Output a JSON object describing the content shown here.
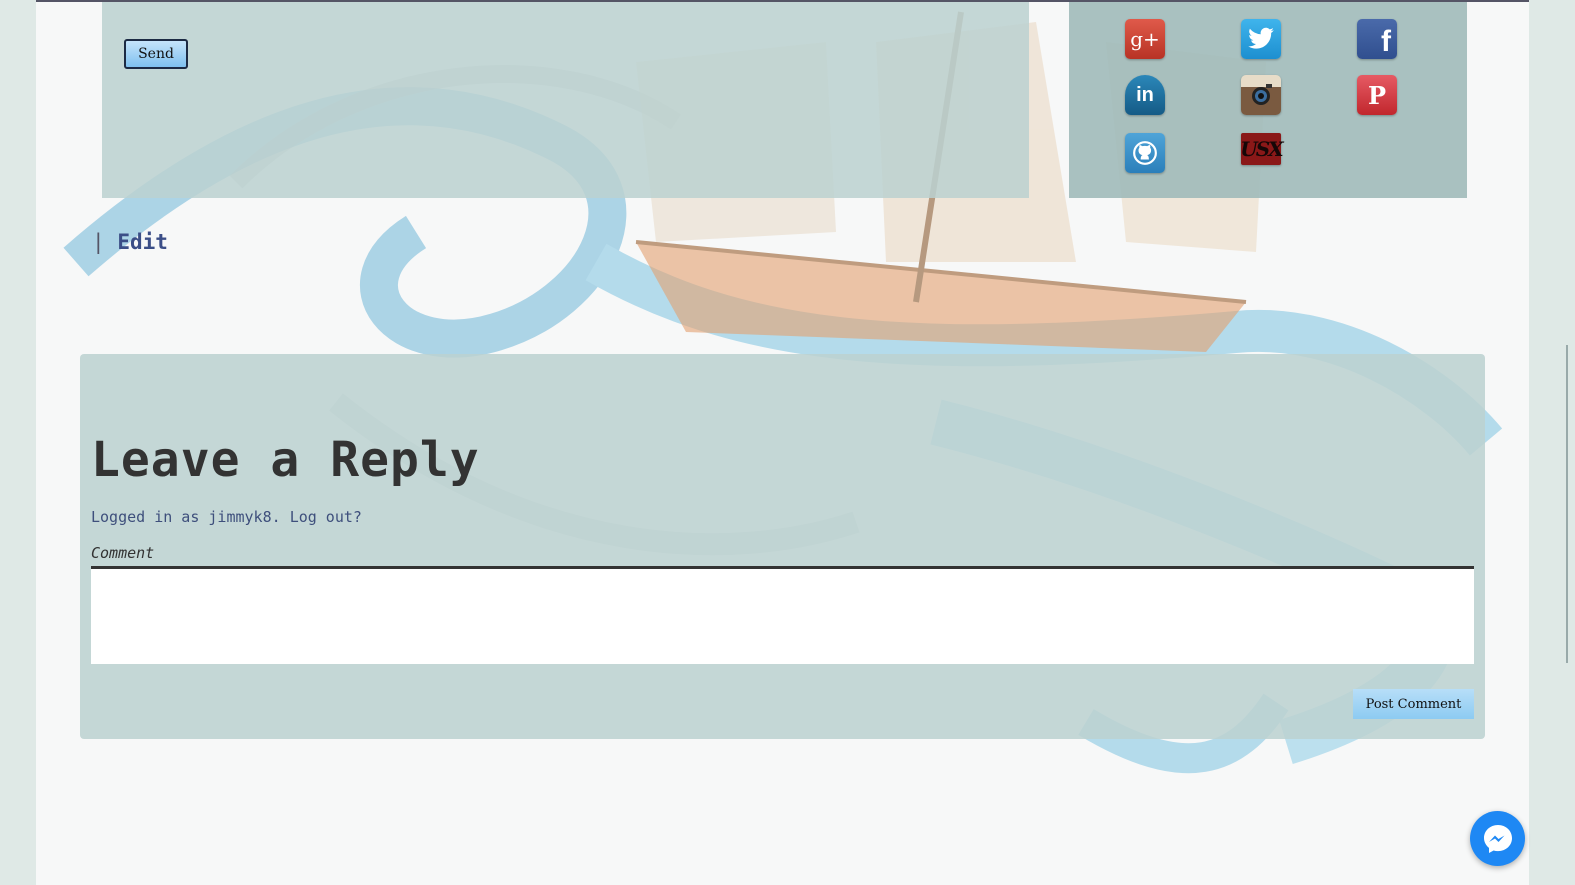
{
  "contact_form": {
    "send_label": "Send"
  },
  "social": {
    "icons": [
      {
        "name": "google-plus-icon",
        "glyph": "g+"
      },
      {
        "name": "twitter-icon",
        "glyph": ""
      },
      {
        "name": "facebook-icon",
        "glyph": "f"
      },
      {
        "name": "linkedin-icon",
        "glyph": "in"
      },
      {
        "name": "instagram-icon",
        "glyph": ""
      },
      {
        "name": "pinterest-icon",
        "glyph": "P"
      },
      {
        "name": "github-icon",
        "glyph": ""
      },
      {
        "name": "custom-logo-icon",
        "glyph": "USX"
      }
    ]
  },
  "post": {
    "separator": "|",
    "edit_label": "Edit"
  },
  "reply": {
    "title": "Leave a Reply",
    "logged_in_prefix": "Logged in as",
    "username": "jimmyk8",
    "log_out_label": "Log out?",
    "comment_label": "Comment",
    "comment_value": "",
    "post_button_label": "Post Comment"
  },
  "colors": {
    "panel": "#bcd2d0",
    "link": "#3b4e87",
    "button_gradient_top": "#c5e4fb",
    "messenger": "#1e88f4"
  }
}
